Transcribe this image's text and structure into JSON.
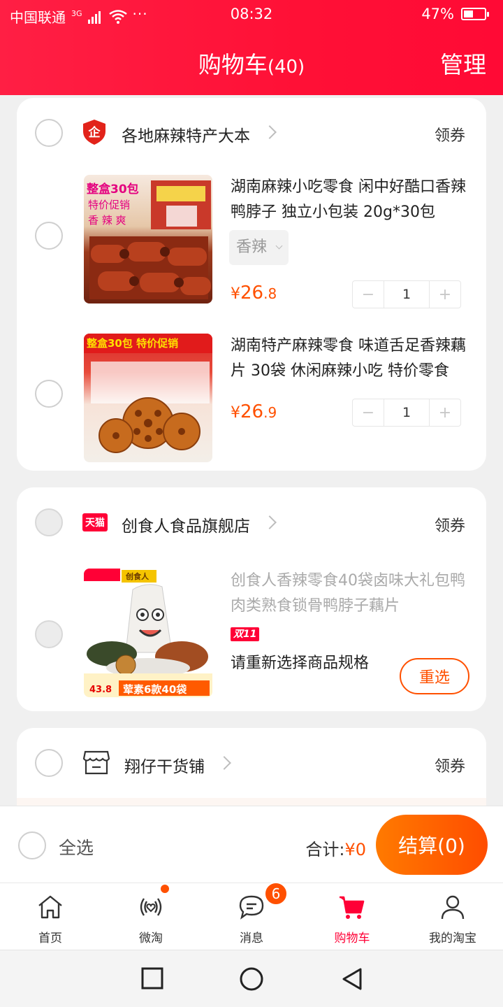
{
  "status_bar": {
    "carrier": "中国联通",
    "network": "3G",
    "time": "08:32",
    "battery": "47%",
    "battery_level": 0.47
  },
  "header": {
    "title": "购物车",
    "count": "(40)",
    "manage": "管理"
  },
  "shops": [
    {
      "name": "各地麻辣特产大本",
      "coupon": "领券",
      "items": [
        {
          "title": "湖南麻辣小吃零食 闲中好酷口香辣鸭脖子 独立小包装 20g*30包",
          "spec": "香辣",
          "price_symbol": "¥",
          "price_int": "26",
          "price_dec": ".8",
          "qty": "1",
          "img_text": [
            "整盒30包",
            "特价促销",
            "香 辣 爽"
          ]
        },
        {
          "title": "湖南特产麻辣零食 味道舌足香辣藕片 30袋 休闲麻辣小吃 特价零食",
          "price_symbol": "¥",
          "price_int": "26",
          "price_dec": ".9",
          "qty": "1",
          "img_text": [
            "整盒30包 特价促销"
          ]
        }
      ]
    },
    {
      "name": "创食人食品旗舰店",
      "badge": "天猫",
      "coupon": "领券",
      "items": [
        {
          "title": "创食人香辣零食40袋卤味大礼包鸭肉类熟食锁骨鸭脖子藕片",
          "badge": "双11",
          "reselect_msg": "请重新选择商品规格",
          "reselect_btn": "重选",
          "img_text": [
            "创食人",
            "荤素6款40袋",
            "43.8"
          ]
        }
      ]
    },
    {
      "name": "翔仔干货铺",
      "coupon": "领券"
    }
  ],
  "bottom": {
    "select_all": "全选",
    "total_label": "合计:",
    "total_amount": "¥0",
    "checkout": "结算(0)"
  },
  "tabs": [
    {
      "label": "首页",
      "icon": "home-icon"
    },
    {
      "label": "微淘",
      "icon": "weitao-icon"
    },
    {
      "label": "消息",
      "icon": "message-icon",
      "badge": "6"
    },
    {
      "label": "购物车",
      "icon": "cart-icon"
    },
    {
      "label": "我的淘宝",
      "icon": "profile-icon"
    }
  ],
  "colors": {
    "header_red": "#ff1f44",
    "accent_orange": "#ff5000",
    "active_tab": "#ff0036"
  }
}
